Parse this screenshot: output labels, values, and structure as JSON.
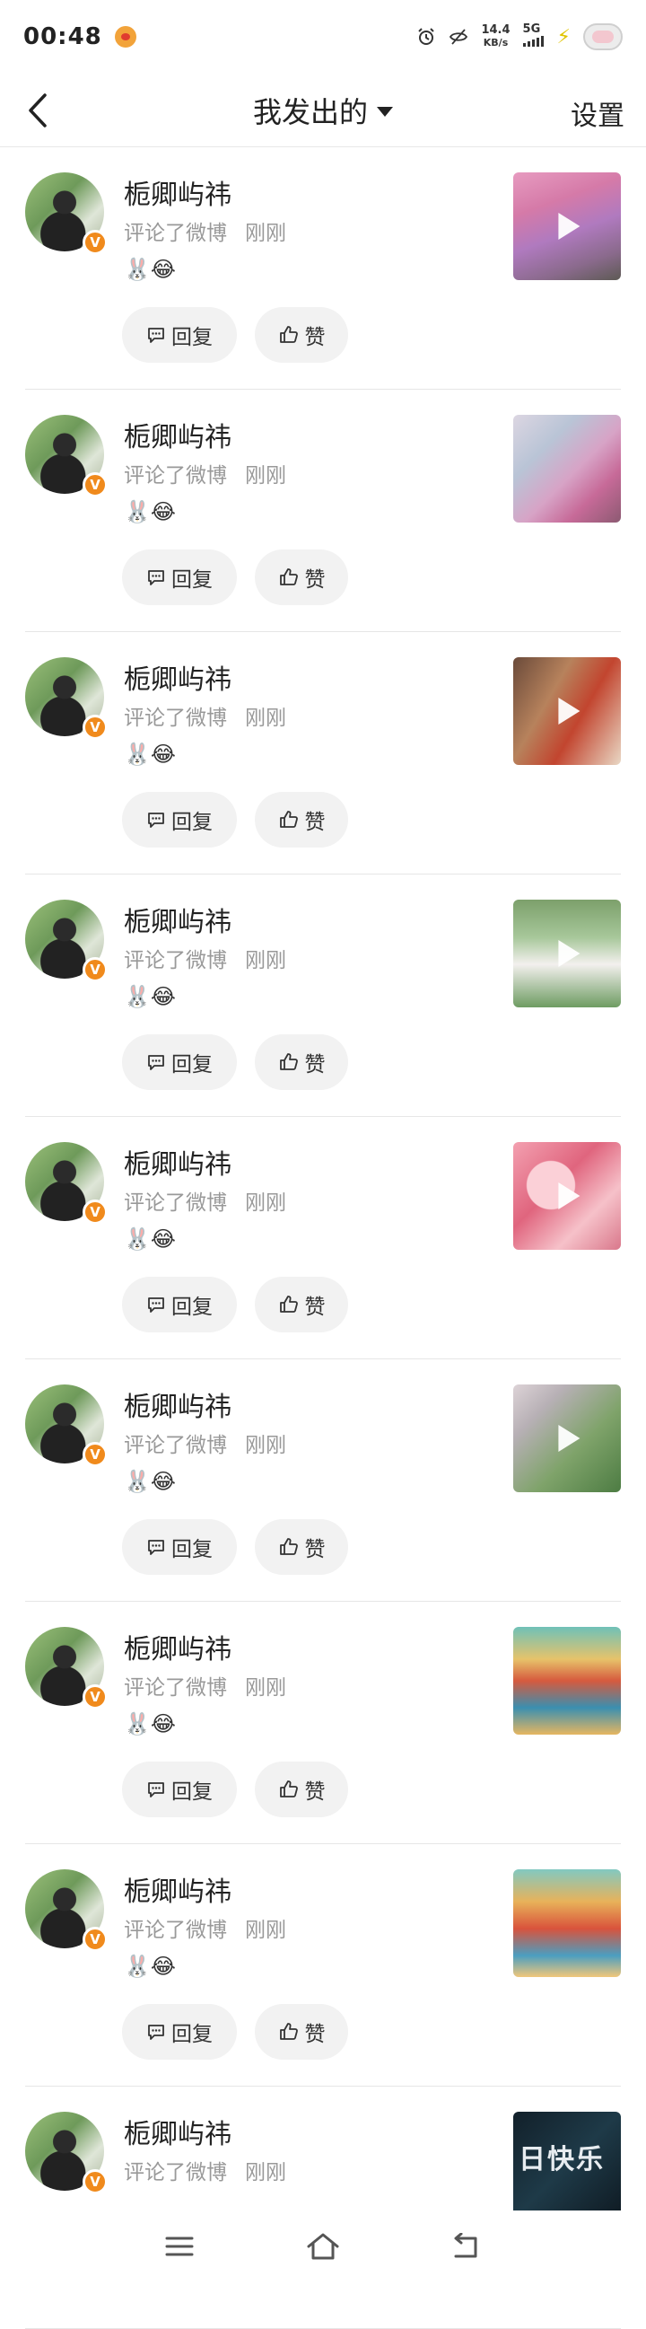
{
  "status_bar": {
    "time": "00:48",
    "net_speed_value": "14.4",
    "net_speed_unit": "KB/s",
    "network": "5G"
  },
  "header": {
    "title": "我发出的",
    "settings_label": "设置"
  },
  "items": [
    {
      "name": "栀卿屿祎",
      "action": "评论了微博",
      "time": "刚刚",
      "emoji": "🐰😂",
      "reply_label": "回复",
      "like_label": "赞",
      "thumb_text": ""
    },
    {
      "name": "栀卿屿祎",
      "action": "评论了微博",
      "time": "刚刚",
      "emoji": "🐰😂",
      "reply_label": "回复",
      "like_label": "赞",
      "thumb_text": ""
    },
    {
      "name": "栀卿屿祎",
      "action": "评论了微博",
      "time": "刚刚",
      "emoji": "🐰😂",
      "reply_label": "回复",
      "like_label": "赞",
      "thumb_text": ""
    },
    {
      "name": "栀卿屿祎",
      "action": "评论了微博",
      "time": "刚刚",
      "emoji": "🐰😂",
      "reply_label": "回复",
      "like_label": "赞",
      "thumb_text": ""
    },
    {
      "name": "栀卿屿祎",
      "action": "评论了微博",
      "time": "刚刚",
      "emoji": "🐰😂",
      "reply_label": "回复",
      "like_label": "赞",
      "thumb_text": ""
    },
    {
      "name": "栀卿屿祎",
      "action": "评论了微博",
      "time": "刚刚",
      "emoji": "🐰😂",
      "reply_label": "回复",
      "like_label": "赞",
      "thumb_text": ""
    },
    {
      "name": "栀卿屿祎",
      "action": "评论了微博",
      "time": "刚刚",
      "emoji": "🐰😂",
      "reply_label": "回复",
      "like_label": "赞",
      "thumb_text": ""
    },
    {
      "name": "栀卿屿祎",
      "action": "评论了微博",
      "time": "刚刚",
      "emoji": "🐰😂",
      "reply_label": "回复",
      "like_label": "赞",
      "thumb_text": ""
    },
    {
      "name": "栀卿屿祎",
      "action": "评论了微博",
      "time": "刚刚",
      "emoji": "",
      "reply_label": "",
      "like_label": "",
      "thumb_text": "日快乐"
    }
  ],
  "verified_badge": "V",
  "colors": {
    "verified_badge": "#f08a1c",
    "button_bg": "#f2f2f2",
    "meta_text": "#999999"
  }
}
